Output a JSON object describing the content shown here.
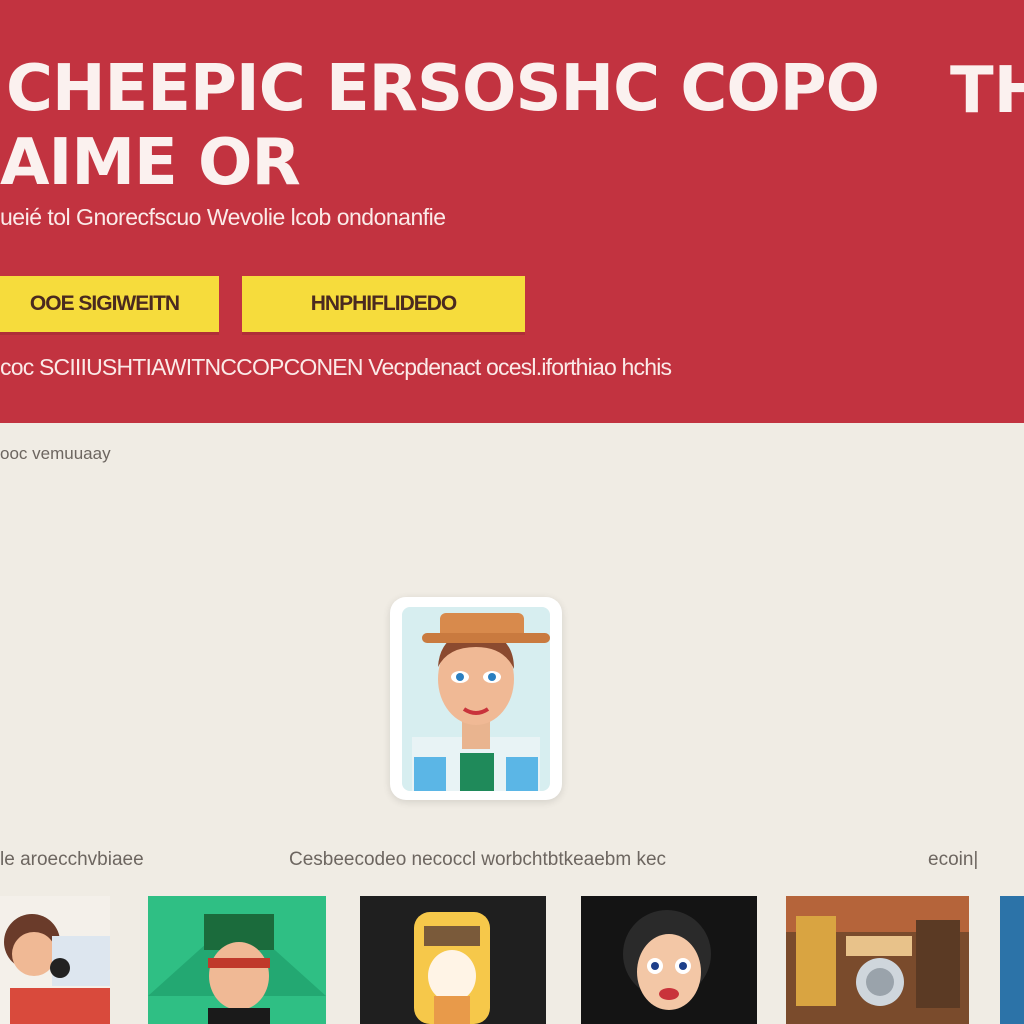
{
  "hero": {
    "title_line1": "CHEEPIC ERSOSHC COPO",
    "title_line2": "AIME OR",
    "title_edge": "TH",
    "subtitle": "ueié tol Gnorecfscuo Wevolie lcob ondonanfie",
    "button_primary": "OOE SIGIWEITN",
    "button_secondary": "HNPHIFLIDEDO",
    "note": "coc SCIIIUSHTIAWITNCCOPCONEN Vecpdenact ocesl.iforthiao hchis"
  },
  "section": {
    "label": "ooc vemuuaay"
  },
  "captions": [
    "le aroecchvbiaee",
    "Cesbeecodeo necoccl worbchtbtkeaebm kec",
    "ecoin|"
  ],
  "colors": {
    "hero_red": "#c23340",
    "button_yellow": "#f6dc3c",
    "page_bg": "#f0ece4",
    "text_light": "#fbf1ef"
  },
  "icons": {
    "profile": "avatar-portrait-icon",
    "thumbnails": [
      "collage-thumbnail",
      "green-character-thumbnail",
      "yellow-character-thumbnail",
      "cartoon-face-thumbnail",
      "room-scene-thumbnail",
      "blue-thumbnail"
    ]
  }
}
